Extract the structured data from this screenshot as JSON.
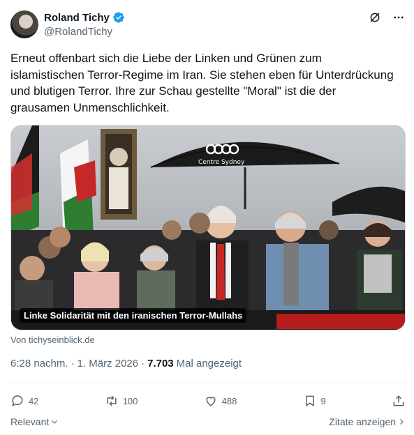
{
  "author": {
    "name": "Roland Tichy",
    "handle": "@RolandTichy",
    "verified": true
  },
  "tweet": {
    "text": "Erneut offenbart sich die Liebe der Linken und Grünen zum\nislamistischen Terror-Regime im Iran. Sie stehen eben für Unterdrückung\nund blutigen Terror. Ihre zur Schau gestellte \"Moral\" ist die der\ngrausamen Unmenschlichkeit."
  },
  "media": {
    "caption": "Linke Solidarität mit den iranischen Terror-Mullahs",
    "umbrella_text": "Centre Sydney"
  },
  "card_source": "Von tichyseinblick.de",
  "meta": {
    "time": "6:28 nachm.",
    "date": "1. März 2026",
    "views": "7.703",
    "views_label": "Mal angezeigt",
    "sep": "·"
  },
  "actions": {
    "replies": "42",
    "reposts": "100",
    "likes": "488",
    "bookmarks": "9"
  },
  "footer": {
    "relevant": "Relevant",
    "quotes": "Zitate anzeigen"
  },
  "colors": {
    "verified_blue": "#1d9bf0",
    "text_secondary": "#536471",
    "text_primary": "#0f1419"
  }
}
